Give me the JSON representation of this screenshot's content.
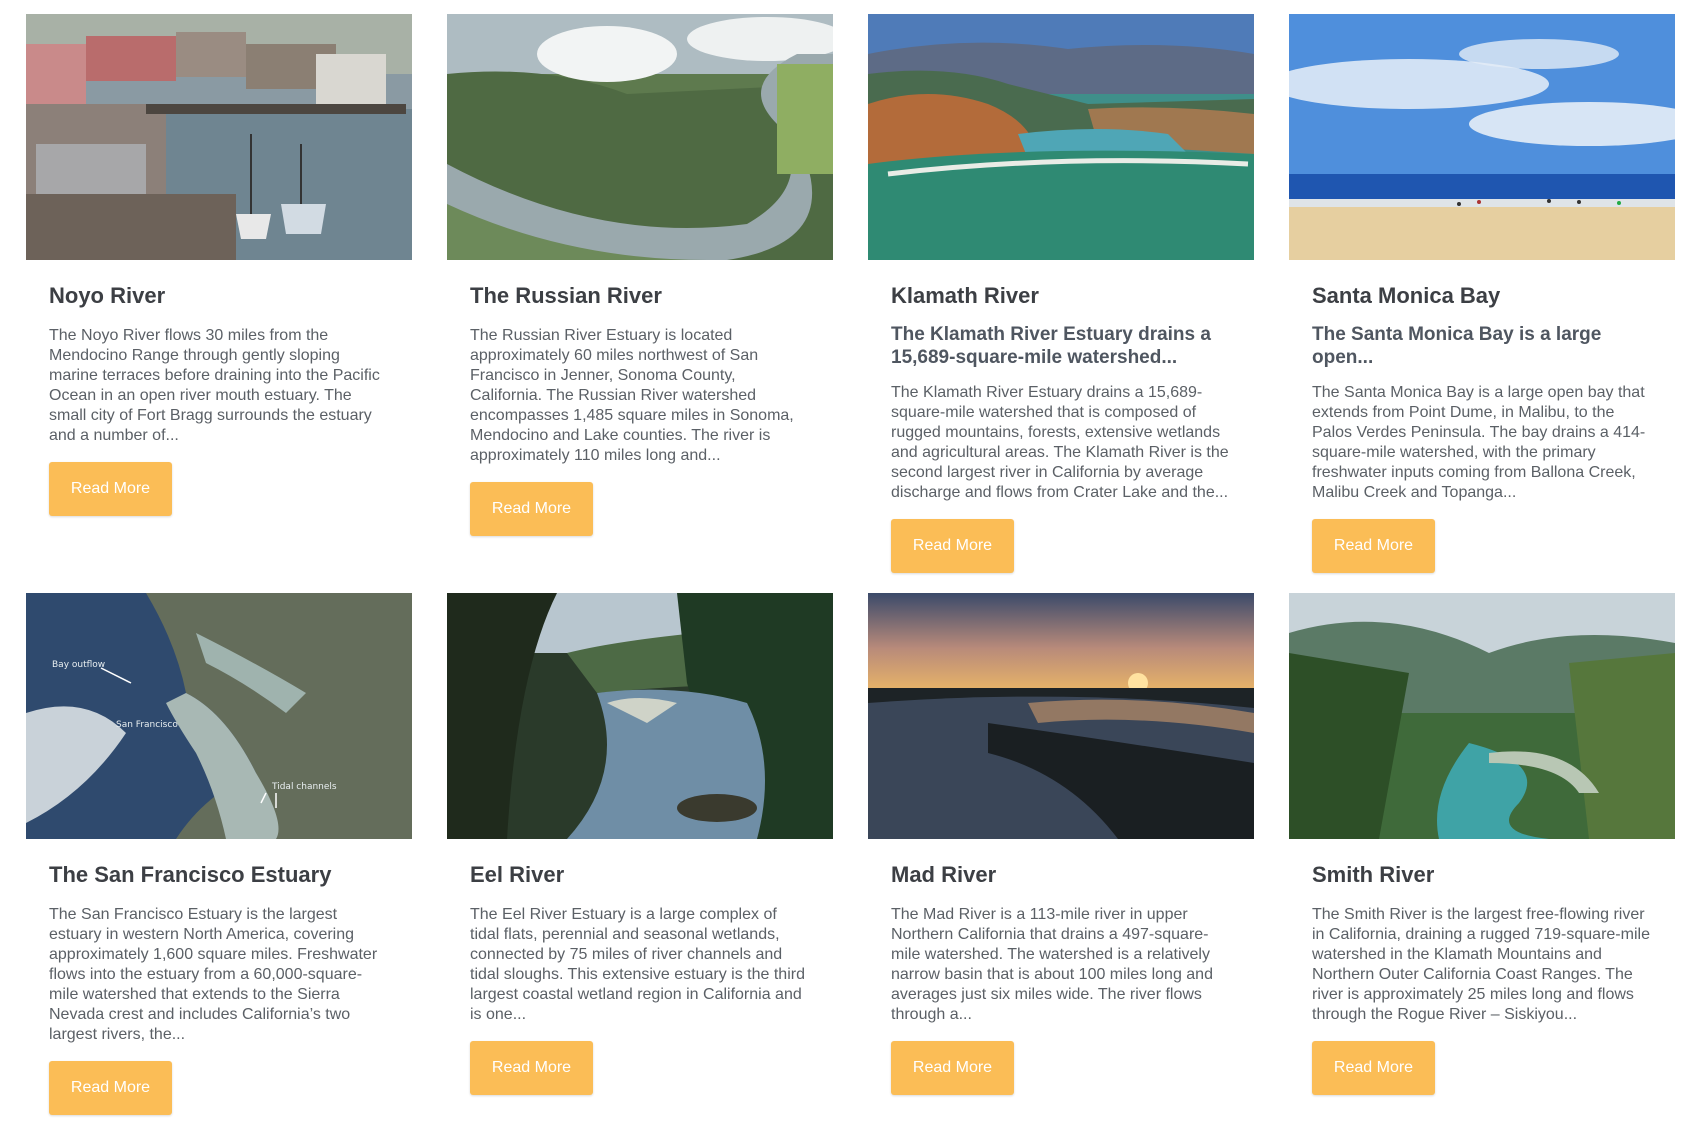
{
  "button_label": "Read More",
  "accent_color": "#fbbd56",
  "cards": [
    {
      "title": "Noyo River",
      "subtitle": "",
      "description": "The Noyo River flows 30 miles from the Mendocino Range through gently sloping marine terraces before draining into the Pacific Ocean in an open river mouth estuary. The small city of Fort Bragg surrounds the estuary and a number of...",
      "button": "Read More"
    },
    {
      "title": "The Russian River",
      "subtitle": "",
      "description": "The Russian River Estuary is located approximately 60 miles northwest of San Francisco in Jenner, Sonoma County, California. The Russian River watershed encompasses 1,485 square miles in Sonoma, Mendocino and Lake counties. The river is approximately 110 miles long and...",
      "button": "Read More"
    },
    {
      "title": "Klamath River",
      "subtitle": "The Klamath River Estuary drains a 15,689-square-mile watershed...",
      "description": "The Klamath River Estuary drains a 15,689-square-mile watershed that is composed of rugged mountains, forests, extensive wetlands and agricultural areas. The Klamath River is the second largest river in California by average discharge and flows from Crater Lake and the...",
      "button": "Read More"
    },
    {
      "title": "Santa Monica Bay",
      "subtitle": "The Santa Monica Bay is a large open...",
      "description": "The Santa Monica Bay is a large open bay that extends from Point Dume, in Malibu, to the Palos Verdes Peninsula. The bay drains a 414-square-mile watershed, with the primary freshwater inputs coming from Ballona Creek, Malibu Creek and Topanga...",
      "button": "Read More"
    },
    {
      "title": "The San Francisco Estuary",
      "subtitle": "",
      "description": "The San Francisco Estuary is the largest estuary in western North America, covering approximately 1,600 square miles. Freshwater flows into the estuary from a 60,000-square-mile watershed that extends to the Sierra Nevada crest and includes California’s two largest rivers, the...",
      "button": "Read More",
      "map_labels": [
        "Bay outflow",
        "San Francisco",
        "Tidal channels"
      ]
    },
    {
      "title": "Eel River",
      "subtitle": "",
      "description": "The Eel River Estuary is a large complex of tidal flats, perennial and seasonal wetlands, connected by 75 miles of river channels and tidal sloughs. This extensive estuary is the third largest coastal wetland region in California and is one...",
      "button": "Read More"
    },
    {
      "title": "Mad River",
      "subtitle": "",
      "description": "The Mad River is a 113-mile river in upper Northern California that drains a 497-square-mile watershed. The watershed is a relatively narrow basin that is about 100 miles long and averages just six miles wide. The river flows through a...",
      "button": "Read More"
    },
    {
      "title": "Smith River",
      "subtitle": "",
      "description": "The Smith River is the largest free-flowing river in California, draining a rugged 719-square-mile watershed in the Klamath Mountains and Northern Outer California Coast Ranges. The river is approximately 25 miles long and flows through the Rogue River – Siskiyou...",
      "button": "Read More"
    }
  ]
}
